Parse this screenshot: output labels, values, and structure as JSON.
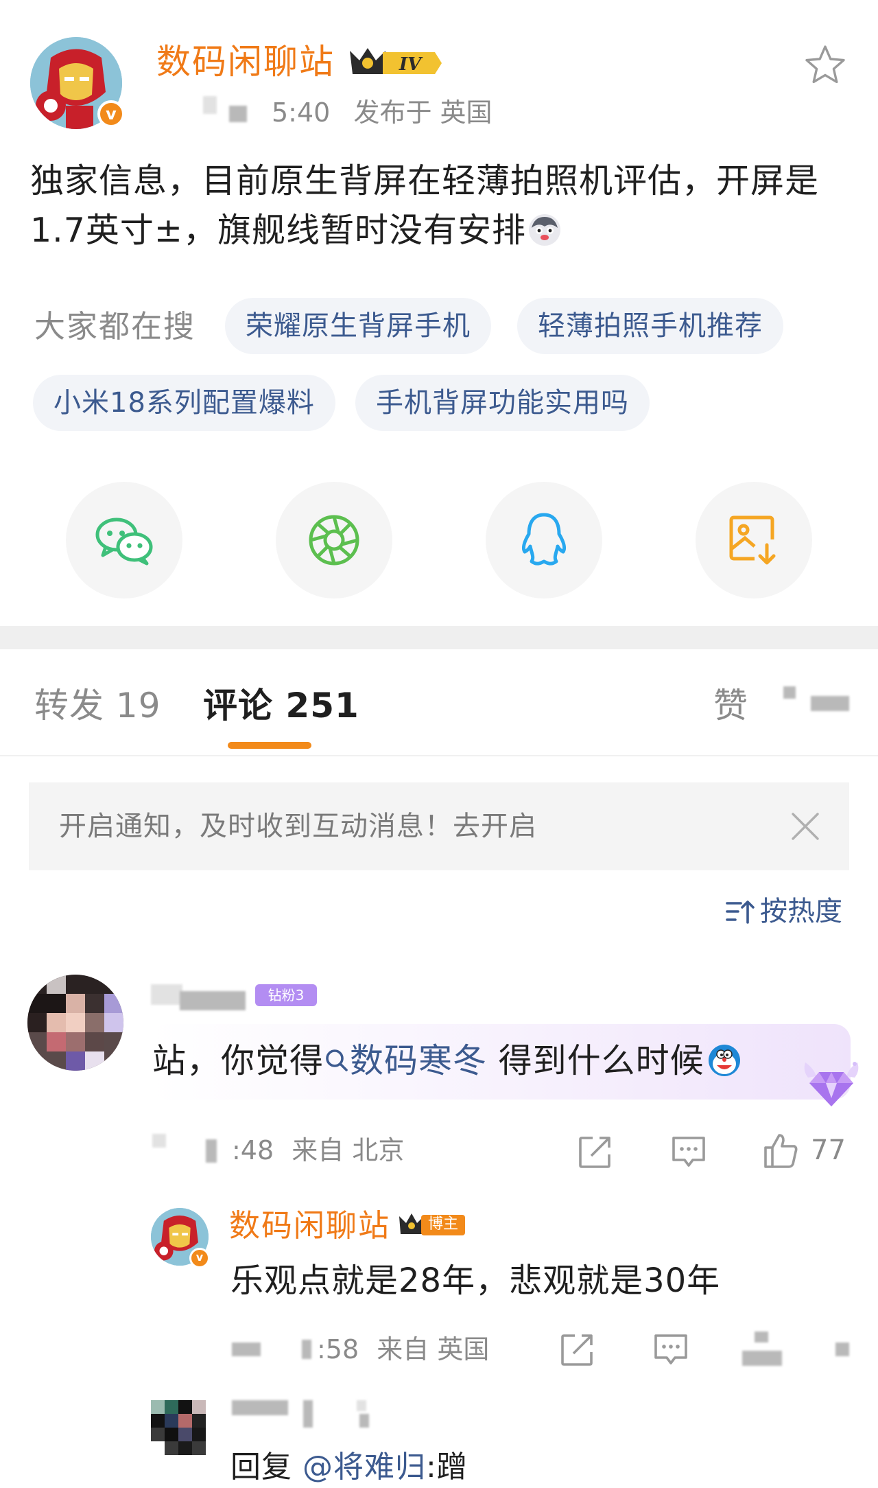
{
  "post": {
    "author_name": "数码闲聊站",
    "level_badge": "IV",
    "time": "5:40",
    "location": "发布于 英国",
    "text": "独家信息，目前原生背屏在轻薄拍照机评估，开屏是1.7英寸±，旗舰线暂时没有安排",
    "text_emoji": "husky-emoji",
    "favorite_icon": "star-outline-icon"
  },
  "search": {
    "label": "大家都在搜",
    "tags": [
      "荣耀原生背屏手机",
      "轻薄拍照手机推荐",
      "小米18系列配置爆料",
      "手机背屏功能实用吗"
    ]
  },
  "share": {
    "targets": [
      {
        "icon": "wechat-icon",
        "color": "#3fc07a"
      },
      {
        "icon": "moments-icon",
        "color": "#5cbf4f"
      },
      {
        "icon": "qq-icon",
        "color": "#28a8ef"
      },
      {
        "icon": "save-image-icon",
        "color": "#f5a623"
      }
    ]
  },
  "tabs": {
    "repost": "转发 19",
    "comments": "评论 251",
    "likes": "赞"
  },
  "colors": {
    "accent": "#f28a1a",
    "author": "#f07a17",
    "link": "#3c5a8f"
  },
  "notice": {
    "text": "开启通知，及时收到互动消息！去开启"
  },
  "sort": {
    "label": "按热度"
  },
  "comments": [
    {
      "badge": "钻粉3",
      "text_before": "站，你觉得",
      "topic": "数码寒冬",
      "text_after": " 得到什么时候",
      "time": ":48",
      "location": "来自 北京",
      "like_count": "77"
    }
  ],
  "reply": {
    "author_name": "数码闲聊站",
    "badge": "博主",
    "text": "乐观点就是28年，悲观就是30年",
    "time": ":58",
    "location": "来自 英国"
  },
  "third_comment": {
    "reply_prefix": "回复 ",
    "mention": "@将难归",
    "suffix": ":蹭"
  }
}
